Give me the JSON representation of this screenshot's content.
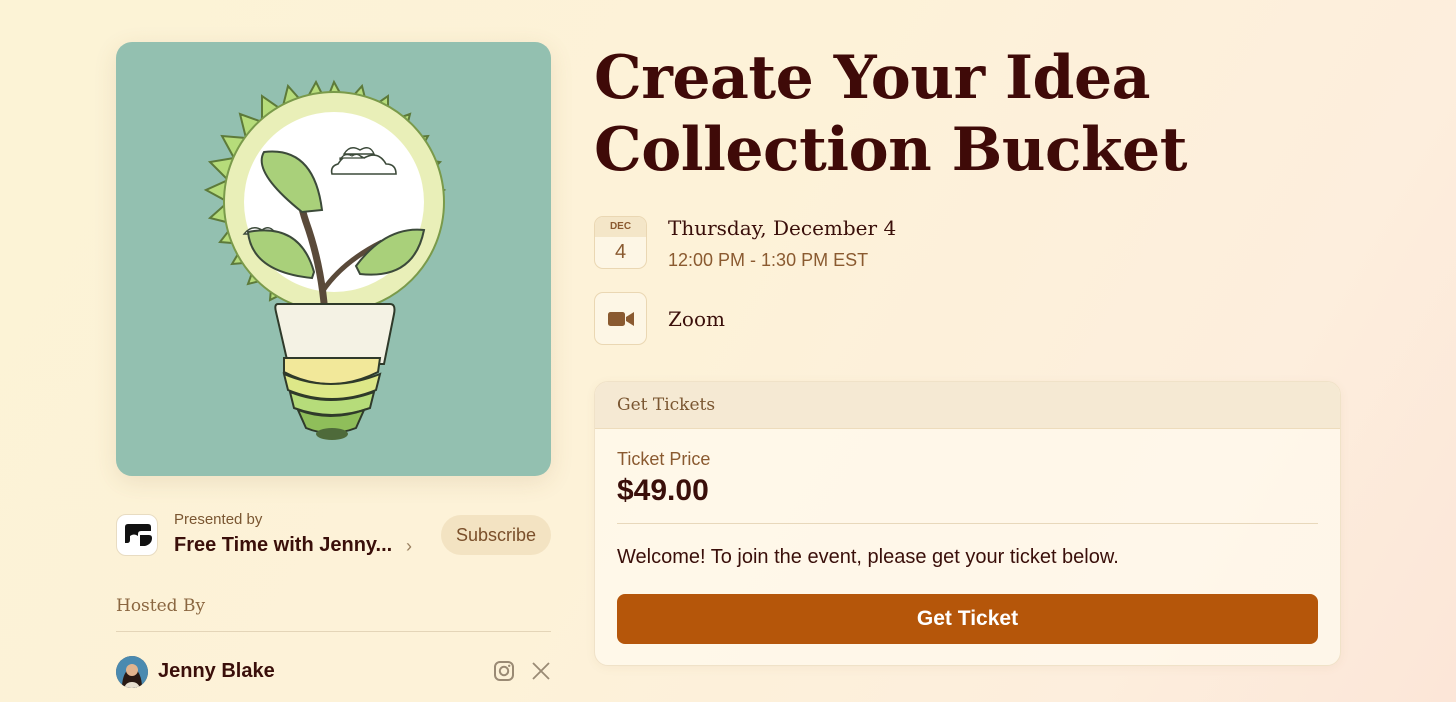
{
  "event": {
    "title_line1": "Create Your Idea",
    "title_line2": "Collection Bucket",
    "cover_image": "lightbulb-with-sprouting-plant"
  },
  "presenter": {
    "label": "Presented by",
    "name": "Free Time with Jenny...",
    "subscribe_label": "Subscribe"
  },
  "hosts": {
    "label": "Hosted By",
    "items": [
      {
        "name": "Jenny Blake",
        "socials": [
          "instagram-icon",
          "x-icon"
        ]
      }
    ]
  },
  "date": {
    "month": "DEC",
    "day": "4",
    "title": "Thursday, December 4",
    "time": "12:00 PM - 1:30 PM EST"
  },
  "location": {
    "icon": "video-camera-icon",
    "label": "Zoom"
  },
  "tickets": {
    "header": "Get Tickets",
    "price_label": "Ticket Price",
    "price": "$49.00",
    "welcome": "Welcome! To join the event, please get your ticket below.",
    "button_label": "Get Ticket"
  },
  "colors": {
    "accent": "#b5560a",
    "title": "#3f0a08",
    "muted": "#8a5a30",
    "cover_bg": "#93c0b0"
  }
}
